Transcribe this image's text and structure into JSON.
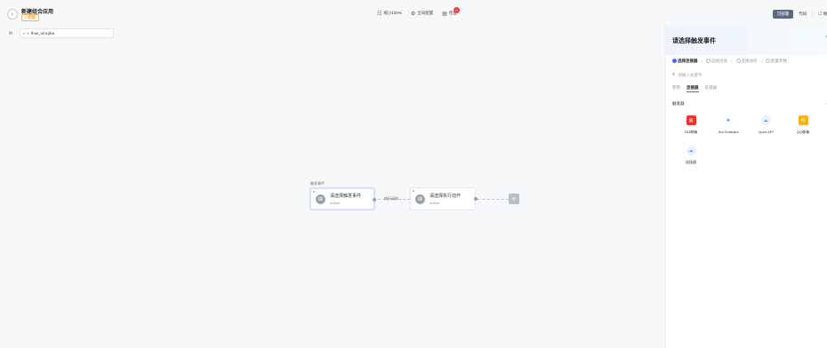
{
  "header": {
    "app_title": "新建组合应用",
    "draft_tag": "• 草稿",
    "center_items": [
      {
        "icon": "grid-icon",
        "glyph": "☷",
        "label": "缩小100%"
      },
      {
        "icon": "gear-icon",
        "glyph": "⚙",
        "label": "全局配置"
      },
      {
        "icon": "list-icon",
        "glyph": "▤",
        "label": "检查"
      }
    ],
    "check_badge": "0",
    "right_buttons": {
      "primary": "可部署",
      "second": "代码",
      "third": "保"
    }
  },
  "flow": {
    "name": "flow_nmcyka"
  },
  "canvas": {
    "group_label": "触发事件",
    "trigger_node": {
      "title": "请选择触发事件",
      "subtitle": "Action"
    },
    "action_node": {
      "title": "请选择执行动作",
      "subtitle": "Action"
    },
    "connector_label": "执行动作"
  },
  "panel": {
    "title": "请选择触发事件",
    "steps": [
      "选择连接器",
      "选择连接",
      "选择动作",
      "配置参数"
    ],
    "search_placeholder": "请输入关键字",
    "tabs": [
      "使用",
      "连接器",
      "处理器"
    ],
    "active_tab_index": 1,
    "section_label": "触发器",
    "apps": [
      {
        "label": "163邮箱",
        "icon": "mail-163-icon",
        "color": "#e8352f",
        "glyph": "▥"
      },
      {
        "label": "Jira Software",
        "icon": "jira-icon",
        "color": "#ffffff",
        "glyph": "❖"
      },
      {
        "label": "Open API",
        "icon": "open-api-icon",
        "color": "#ffffff",
        "glyph": "☁"
      },
      {
        "label": "QQ邮箱",
        "icon": "qq-mail-icon",
        "color": "#f4b31c",
        "glyph": "✉"
      },
      {
        "label": "连接器",
        "icon": "connector-icon",
        "color": "#ffffff",
        "glyph": "☁"
      }
    ]
  }
}
